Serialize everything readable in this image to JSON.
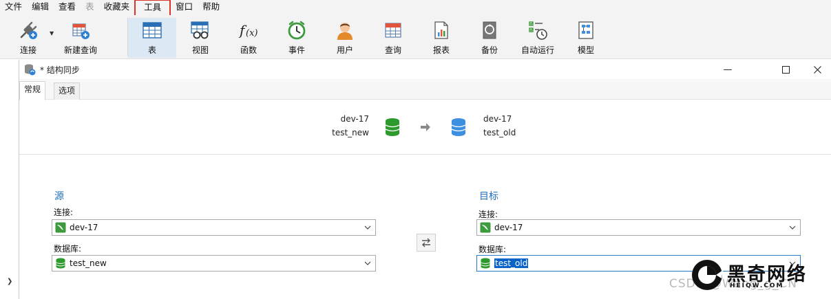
{
  "menu": {
    "items": [
      "文件",
      "编辑",
      "查看",
      "表",
      "收藏夹",
      "工具",
      "窗口",
      "帮助"
    ]
  },
  "toolbar": {
    "connect": "连接",
    "new_query": "新建查询",
    "table": "表",
    "view": "视图",
    "function": "函数",
    "event": "事件",
    "user": "用户",
    "query": "查询",
    "report": "报表",
    "backup": "备份",
    "automation": "自动运行",
    "model": "模型"
  },
  "dialog": {
    "title": "* 结构同步",
    "tabs": [
      "常规",
      "选项"
    ],
    "summary": {
      "source_connection": "dev-17",
      "source_database": "test_new",
      "target_connection": "dev-17",
      "target_database": "test_old"
    },
    "source": {
      "heading": "源",
      "connection_label": "连接:",
      "connection_value": "dev-17",
      "database_label": "数据库:",
      "database_value": "test_new"
    },
    "target": {
      "heading": "目标",
      "connection_label": "连接:",
      "connection_value": "dev-17",
      "database_label": "数据库:",
      "database_value": "test_old"
    }
  },
  "watermark": {
    "csdn": "CSDN @Wang_g_CN",
    "brand": "黑奇网络",
    "site": "HEIQW.COM"
  },
  "colors": {
    "accent": "#1e6fbf",
    "source_db": "#2e9a2e",
    "target_db": "#3d8fe0",
    "highlight_border": "#e0302b",
    "selection": "#0a64c8"
  }
}
